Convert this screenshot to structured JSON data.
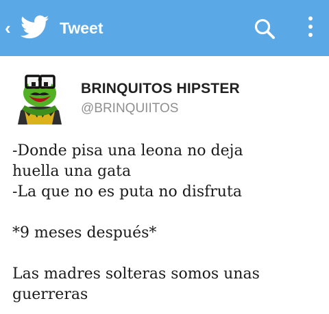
{
  "topbar": {
    "title": "Tweet",
    "icons": [
      "back-chevron-icon",
      "twitter-bird-icon",
      "search-icon",
      "overflow-menu-icon"
    ],
    "background": "#5aa8e6"
  },
  "author": {
    "display_name": "BRINQUITOS HIPSTER",
    "handle": "@BRINQUIITOS",
    "avatar": "kermit-hipster-avatar"
  },
  "tweet": {
    "lines": [
      "-Donde pisa una leona no deja",
      "huella una gata",
      "-La que no es puta no disfruta",
      "*9 meses después*",
      "Las madres solteras somos unas",
      "guerreras"
    ]
  }
}
